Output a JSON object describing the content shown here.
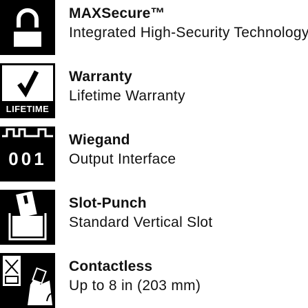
{
  "features": [
    {
      "icon": "lock-icon",
      "title": "MAXSecure™",
      "subtitle": "Integrated High-Security Technology"
    },
    {
      "icon": "checkmark-icon",
      "badge": "LIFETIME",
      "title": "Warranty",
      "subtitle": "Lifetime Warranty"
    },
    {
      "icon": "wiegand-signal-icon",
      "badge": "001",
      "title": "Wiegand",
      "subtitle": "Output Interface"
    },
    {
      "icon": "slot-punch-card-icon",
      "title": "Slot-Punch",
      "subtitle": "Standard Vertical Slot"
    },
    {
      "icon": "contactless-card-icon",
      "title": "Contactless",
      "subtitle": "Up to 8 in (203 mm)"
    }
  ],
  "colors": {
    "tile": "#000000",
    "text": "#111111",
    "background": "#ffffff"
  }
}
